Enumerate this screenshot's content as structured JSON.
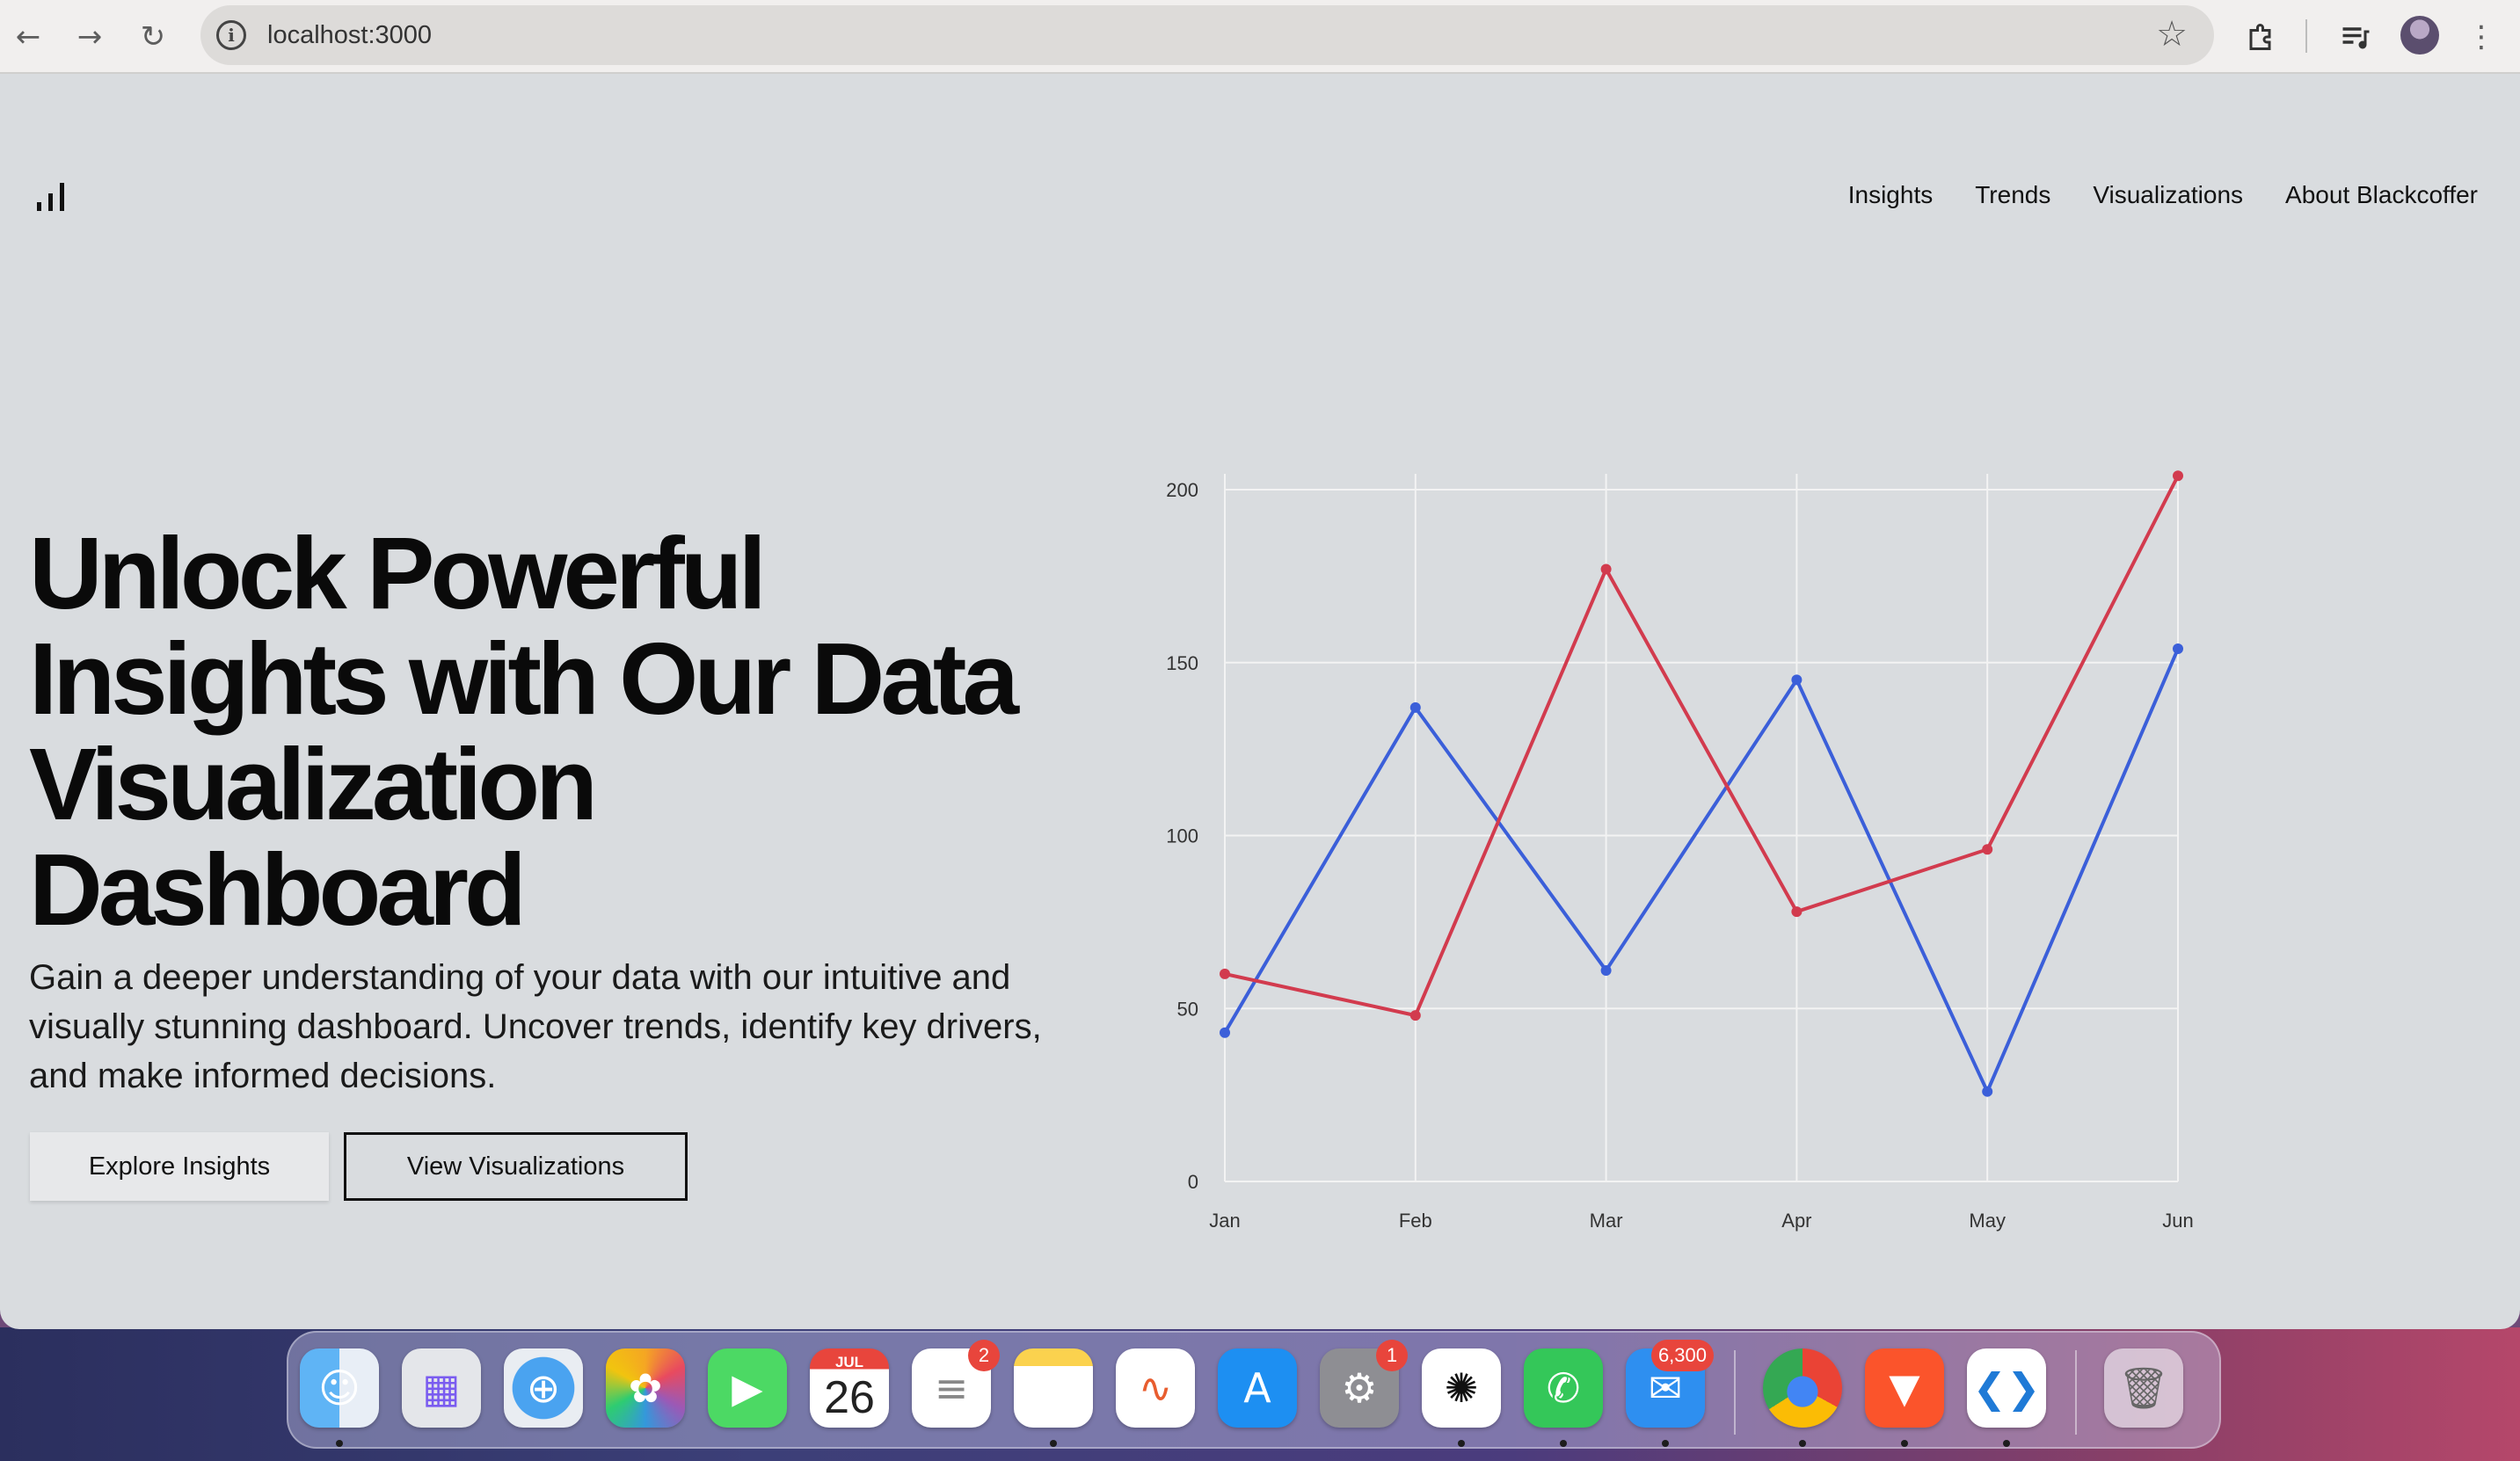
{
  "browser": {
    "url": "localhost:3000",
    "icons": {
      "back": "back-arrow-icon",
      "forward": "forward-arrow-icon",
      "reload": "reload-icon",
      "info": "site-info-icon",
      "bookmark": "star-icon",
      "extensions": "puzzle-icon",
      "media": "media-control-icon",
      "profile": "profile-avatar",
      "menu": "kebab-menu-icon"
    }
  },
  "nav": {
    "items": [
      "Insights",
      "Trends",
      "Visualizations",
      "About Blackcoffer"
    ]
  },
  "hero": {
    "title": "Unlock Powerful Insights with Our Data Visualization Dashboard",
    "subtitle": "Gain a deeper understanding of your data with our intuitive and visually stunning dashboard. Uncover trends, identify key drivers, and make informed decisions.",
    "primary_button": "Explore Insights",
    "secondary_button": "View Visualizations"
  },
  "chart_data": {
    "type": "line",
    "categories": [
      "Jan",
      "Feb",
      "Mar",
      "Apr",
      "May",
      "Jun"
    ],
    "ylim": [
      0,
      200
    ],
    "yticks": [
      0,
      50,
      100,
      150,
      200
    ],
    "grid": true,
    "series": [
      {
        "color": "#3b5fd9",
        "values": [
          43,
          137,
          61,
          145,
          26,
          154
        ]
      },
      {
        "color": "#d23b4e",
        "values": [
          60,
          48,
          177,
          78,
          96,
          204
        ]
      }
    ]
  },
  "dock": {
    "apps": [
      {
        "name": "finder",
        "icon": "finder-icon",
        "running": true
      },
      {
        "name": "launchpad",
        "icon": "launchpad-icon",
        "running": false
      },
      {
        "name": "safari",
        "icon": "safari-compass-icon",
        "running": false
      },
      {
        "name": "photos",
        "icon": "photos-flower-icon",
        "running": false
      },
      {
        "name": "facetime",
        "icon": "facetime-camera-icon",
        "running": false
      },
      {
        "name": "calendar",
        "icon": "calendar-icon",
        "month": "JUL",
        "day": "26",
        "running": false
      },
      {
        "name": "reminders",
        "icon": "reminders-icon",
        "badge": "2",
        "running": false
      },
      {
        "name": "notes",
        "icon": "notes-icon",
        "running": true
      },
      {
        "name": "freeform",
        "icon": "freeform-icon",
        "running": false
      },
      {
        "name": "app-store",
        "icon": "app-store-icon",
        "running": false
      },
      {
        "name": "system-settings",
        "icon": "gear-icon",
        "badge": "1",
        "running": false
      },
      {
        "name": "chatgpt",
        "icon": "chatgpt-icon",
        "running": true
      },
      {
        "name": "whatsapp",
        "icon": "whatsapp-icon",
        "running": true
      },
      {
        "name": "mail",
        "icon": "mail-envelope-icon",
        "badge": "6,300",
        "running": true
      },
      {
        "name": "chrome",
        "icon": "chrome-icon",
        "running": true
      },
      {
        "name": "brave",
        "icon": "brave-lion-icon",
        "running": true
      },
      {
        "name": "vscode",
        "icon": "vscode-icon",
        "running": true
      },
      {
        "name": "trash",
        "icon": "trash-icon",
        "running": false
      }
    ]
  }
}
